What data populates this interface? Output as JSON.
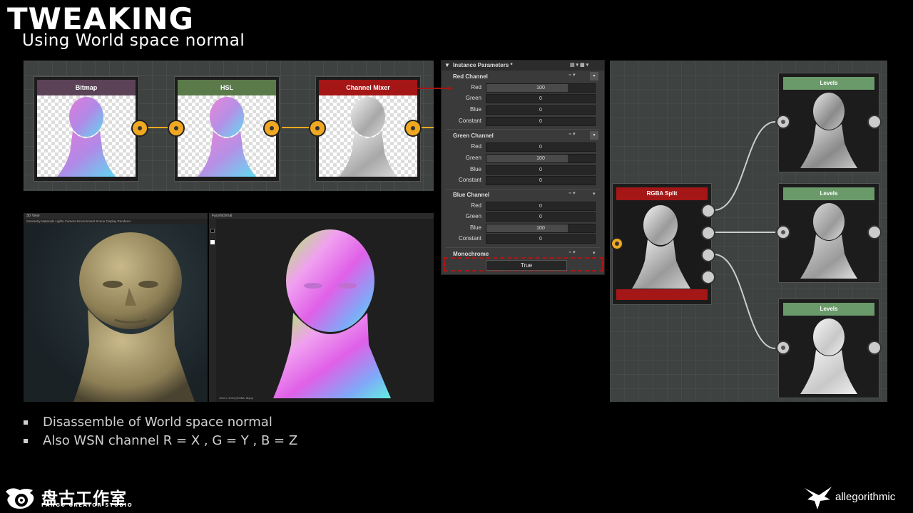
{
  "slide": {
    "title": "TWEAKING",
    "subtitle": "Using World space normal"
  },
  "graph_top": {
    "nodes": [
      {
        "label": "Bitmap",
        "color": "#5b4257"
      },
      {
        "label": "HSL",
        "color": "#5b7a4a"
      },
      {
        "label": "Channel Mixer",
        "color": "#a51616"
      }
    ]
  },
  "viewer3d": {
    "title": "3D View",
    "menu": "Geometry   Materials   Lights   Camera   Environment   Scene   Display   Renderer"
  },
  "viewer2d": {
    "title": "FaceNOrmal",
    "status": "1024 x 1024 (RGBA, 8bpc)"
  },
  "instance_params": {
    "header": "Instance Parameters *",
    "groups": [
      {
        "name": "Red Channel",
        "rows": [
          {
            "label": "Red",
            "value": "100"
          },
          {
            "label": "Green",
            "value": "0"
          },
          {
            "label": "Blue",
            "value": "0"
          },
          {
            "label": "Constant",
            "value": "0"
          }
        ]
      },
      {
        "name": "Green Channel",
        "rows": [
          {
            "label": "Red",
            "value": "0"
          },
          {
            "label": "Green",
            "value": "100"
          },
          {
            "label": "Blue",
            "value": "0"
          },
          {
            "label": "Constant",
            "value": "0"
          }
        ]
      },
      {
        "name": "Blue Channel",
        "rows": [
          {
            "label": "Red",
            "value": "0"
          },
          {
            "label": "Green",
            "value": "0"
          },
          {
            "label": "Blue",
            "value": "100"
          },
          {
            "label": "Constant",
            "value": "0"
          }
        ]
      }
    ],
    "monochrome_label": "Monochrome",
    "monochrome_value": "True"
  },
  "graph_right": {
    "split_label": "RGBA Split",
    "split_color": "#a51616",
    "levels_color": "#6a9a6a",
    "levels": [
      "Levels",
      "Levels",
      "Levels"
    ]
  },
  "bullets": [
    "Disassemble of World space normal",
    "Also WSN channel R = X , G = Y , B = Z"
  ],
  "footer": {
    "pangu_cn": "盘古工作室",
    "pangu_en": "PANGU CREATOR STUDIO",
    "allegorithmic": "allegorithmic"
  },
  "colors": {
    "accent_orange": "#f0a820",
    "highlight_red": "#b01515"
  }
}
